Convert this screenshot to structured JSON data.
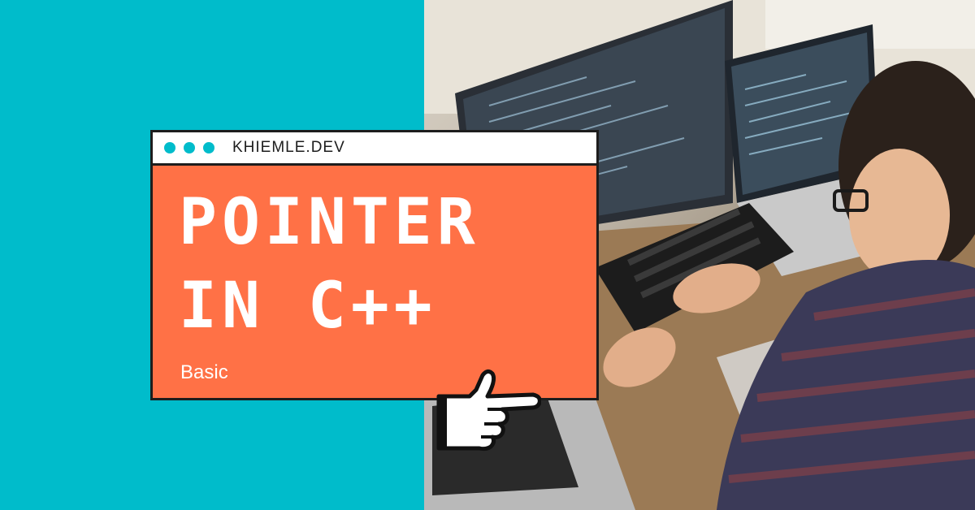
{
  "colors": {
    "background_left": "#00bccb",
    "card_fill": "#ff7146",
    "titlebar_fill": "#ffffff",
    "dot_color": "#00bccb",
    "border": "#1d1d1d",
    "title_text": "#ffffff"
  },
  "window": {
    "site_name": "KHIEMLE.DEV"
  },
  "card": {
    "title_line1": "POINTER",
    "title_line2": "IN C++",
    "subtitle": "Basic"
  },
  "icons": {
    "window_dots": "three-dot-icon",
    "pointer": "pointing-hand-icon"
  }
}
